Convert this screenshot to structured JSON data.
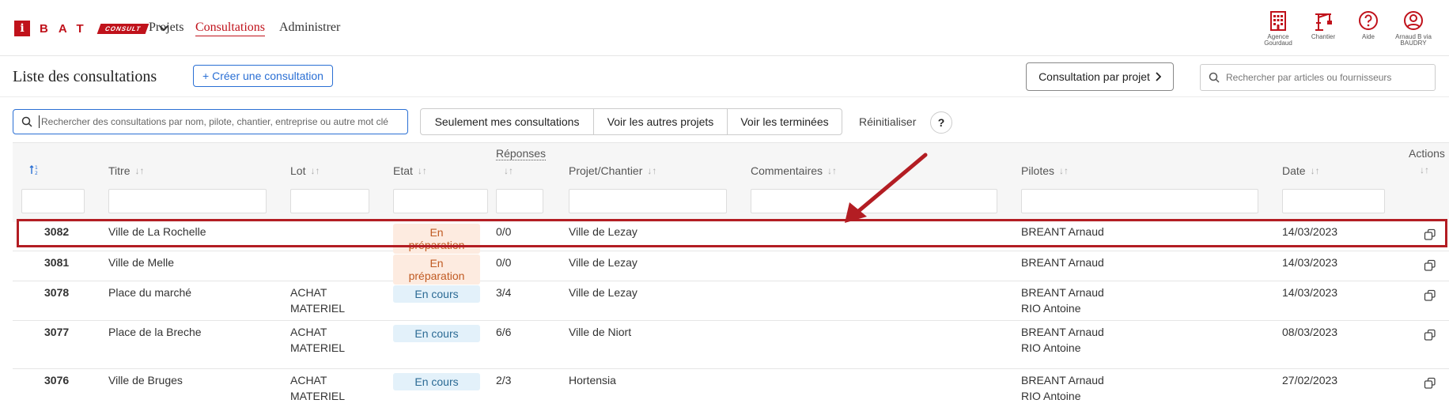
{
  "brand": {
    "i": "i",
    "bat": "BAT",
    "consult": "CONSULT"
  },
  "nav": {
    "projets": "Projets",
    "consultations": "Consultations",
    "administrer": "Administrer"
  },
  "top_icons": [
    {
      "label": "Agence Gourdaud",
      "icon": "building-icon"
    },
    {
      "label": "Chantier",
      "icon": "crane-icon"
    },
    {
      "label": "Aide",
      "icon": "help-circle-icon"
    },
    {
      "label": "Arnaud B via BAUDRY",
      "icon": "user-circle-icon"
    }
  ],
  "page": {
    "title": "Liste des consultations",
    "create_label": "+ Créer une consultation",
    "by_project_label": "Consultation par projet",
    "top_search_placeholder": "Rechercher par articles ou fournisseurs",
    "main_search_placeholder": "Rechercher des consultations par nom, pilote, chantier, entreprise ou autre mot clé"
  },
  "filters": {
    "mine": "Seulement mes consultations",
    "other_projects": "Voir les autres projets",
    "finished": "Voir les terminées",
    "reset": "Réinitialiser",
    "help": "?"
  },
  "columns": {
    "titre": "Titre",
    "lot": "Lot",
    "etat": "Etat",
    "reponses": "Réponses",
    "projet": "Projet/Chantier",
    "commentaires": "Commentaires",
    "pilotes": "Pilotes",
    "date": "Date",
    "actions": "Actions"
  },
  "rows": [
    {
      "id": "3082",
      "titre": "Ville de La Rochelle",
      "lot1": "",
      "lot2": "",
      "etat": "En préparation",
      "etat_kind": "prep",
      "reponses": "0/0",
      "projet": "Ville de Lezay",
      "pilote1": "BREANT Arnaud",
      "pilote2": "",
      "date": "14/03/2023"
    },
    {
      "id": "3081",
      "titre": "Ville de Melle",
      "lot1": "",
      "lot2": "",
      "etat": "En préparation",
      "etat_kind": "prep",
      "reponses": "0/0",
      "projet": "Ville de Lezay",
      "pilote1": "BREANT Arnaud",
      "pilote2": "",
      "date": "14/03/2023"
    },
    {
      "id": "3078",
      "titre": "Place du marché",
      "lot1": "ACHAT",
      "lot2": "MATERIEL",
      "etat": "En cours",
      "etat_kind": "cours",
      "reponses": "3/4",
      "projet": "Ville de Lezay",
      "pilote1": "BREANT Arnaud",
      "pilote2": "RIO Antoine",
      "date": "14/03/2023"
    },
    {
      "id": "3077",
      "titre": "Place de la Breche",
      "lot1": "ACHAT",
      "lot2": "MATERIEL",
      "etat": "En cours",
      "etat_kind": "cours",
      "reponses": "6/6",
      "projet": "Ville de Niort",
      "pilote1": "BREANT Arnaud",
      "pilote2": "RIO Antoine",
      "date": "08/03/2023"
    },
    {
      "id": "3076",
      "titre": "Ville de Bruges",
      "lot1": "ACHAT",
      "lot2": "MATERIEL",
      "etat": "En cours",
      "etat_kind": "cours",
      "reponses": "2/3",
      "projet": "Hortensia",
      "pilote1": "BREANT Arnaud",
      "pilote2": "RIO Antoine",
      "date": "27/02/2023"
    }
  ],
  "colors": {
    "brand_red": "#c0121b",
    "accent_blue": "#2a6fd4",
    "highlight_red": "#b31d23"
  }
}
